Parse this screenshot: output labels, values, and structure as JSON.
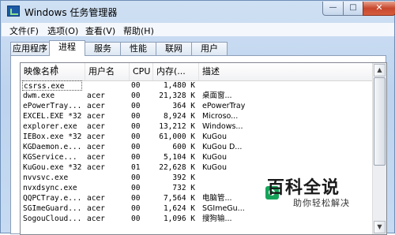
{
  "window": {
    "title": "Windows 任务管理器",
    "min_label": "—",
    "max_label": "□",
    "close_label": "✕"
  },
  "menu": [
    "文件(F)",
    "选项(O)",
    "查看(V)",
    "帮助(H)"
  ],
  "tabs": [
    "应用程序",
    "进程",
    "服务",
    "性能",
    "联网",
    "用户"
  ],
  "active_tab": "进程",
  "columns": [
    "映像名称",
    "用户名",
    "CPU",
    "内存(...",
    "描述"
  ],
  "rows": [
    [
      "csrss.exe",
      "",
      "00",
      "1,480 K",
      ""
    ],
    [
      "dwm.exe",
      "acer",
      "00",
      "21,328 K",
      "桌面窗..."
    ],
    [
      "ePowerTray...",
      "acer",
      "00",
      "364 K",
      "ePowerTray"
    ],
    [
      "EXCEL.EXE *32",
      "acer",
      "00",
      "8,924 K",
      "Microso..."
    ],
    [
      "explorer.exe",
      "acer",
      "00",
      "13,212 K",
      "Windows..."
    ],
    [
      "IEBox.exe *32",
      "acer",
      "00",
      "61,000 K",
      "KuGou"
    ],
    [
      "KGDaemon.e...",
      "acer",
      "00",
      "600 K",
      "KuGou D..."
    ],
    [
      "KGService...",
      "acer",
      "00",
      "5,104 K",
      "KuGou"
    ],
    [
      "KuGou.exe *32",
      "acer",
      "01",
      "22,628 K",
      "KuGou"
    ],
    [
      "nvvsvc.exe",
      "",
      "00",
      "392 K",
      ""
    ],
    [
      "nvxdsync.exe",
      "",
      "00",
      "732 K",
      ""
    ],
    [
      "QQPCTray.e...",
      "acer",
      "00",
      "7,564 K",
      "电脑管..."
    ],
    [
      "SGImeGuard...",
      "acer",
      "00",
      "1,624 K",
      "SGImeGu..."
    ],
    [
      "SogouCloud...",
      "acer",
      "00",
      "1,096 K",
      "搜狗输..."
    ]
  ],
  "watermark": {
    "brand": "百科全说",
    "sub": "助你轻松解决"
  },
  "colors": {
    "titlebar": "#c6dbf2",
    "close": "#c7472d",
    "watermark_logo": "#16a35a"
  }
}
